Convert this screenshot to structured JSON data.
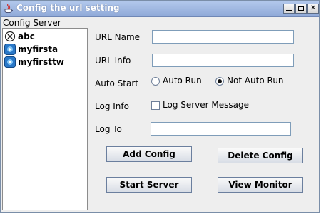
{
  "window": {
    "title": "Config the url setting"
  },
  "titlebar_buttons": {
    "close_glyph": "✕"
  },
  "tree": {
    "header": "Config Server",
    "items": [
      {
        "label": "abc",
        "icon": "stopped-server-icon"
      },
      {
        "label": "myfirsta",
        "icon": "running-server-icon"
      },
      {
        "label": "myfirsttw",
        "icon": "running-server-icon"
      }
    ]
  },
  "form": {
    "url_name_label": "URL Name",
    "url_name_value": "",
    "url_info_label": "URL Info",
    "url_info_value": "",
    "auto_start_label": "Auto Start",
    "auto_run_label": "Auto Run",
    "not_auto_run_label": "Not Auto Run",
    "auto_start_selected": "Not Auto Run",
    "log_info_label": "Log Info",
    "log_server_message_label": "Log Server Message",
    "log_server_message_checked": false,
    "log_to_label": "Log To",
    "log_to_value": ""
  },
  "buttons": {
    "add_config": "Add Config",
    "delete_config": "Delete Config",
    "start_server": "Start Server",
    "view_monitor": "View Monitor"
  },
  "colors": {
    "titlebar": "#9fb6e0",
    "background": "#eeeeee",
    "running_icon": "#2a78c8"
  }
}
